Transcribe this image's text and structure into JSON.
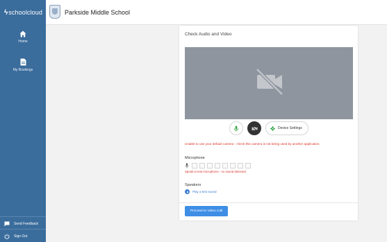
{
  "brand": {
    "bolt": "ϟ",
    "name": "schoolcloud"
  },
  "header": {
    "school_name": "Parkside Middle School"
  },
  "sidebar": {
    "items": [
      {
        "label": "Home",
        "icon": "home-icon"
      },
      {
        "label": "My Bookings",
        "icon": "document-icon"
      }
    ],
    "bottom": [
      {
        "label": "Send Feedback",
        "icon": "feedback-icon"
      },
      {
        "label": "Sign Out",
        "icon": "power-icon"
      }
    ]
  },
  "card": {
    "title": "Check Audio and Video",
    "controls": {
      "settings_label": "Device Settings"
    },
    "error_camera": "Unable to use your default camera - check this camera is not being used by another application",
    "microphone_label": "Microphone",
    "microphone_error": "Speak to test microphone - no sound detected",
    "speakers_label": "Speakers",
    "play_sound_label": "Play a test sound",
    "proceed_label": "Proceed to Video Call"
  },
  "colors": {
    "sidebar": "#3a6c9c",
    "video_bg": "#8e959e",
    "error": "#d9342b",
    "primary": "#3e8ee6"
  }
}
